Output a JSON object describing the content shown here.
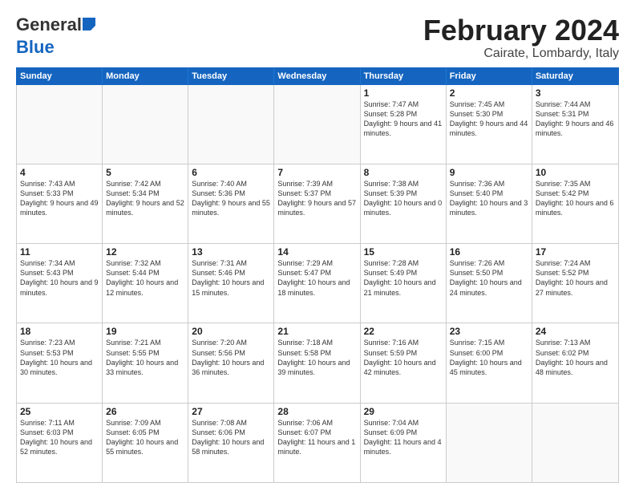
{
  "header": {
    "logo_general": "General",
    "logo_blue": "Blue",
    "month_title": "February 2024",
    "location": "Cairate, Lombardy, Italy"
  },
  "weekdays": [
    "Sunday",
    "Monday",
    "Tuesday",
    "Wednesday",
    "Thursday",
    "Friday",
    "Saturday"
  ],
  "rows": [
    [
      {
        "day": "",
        "text": ""
      },
      {
        "day": "",
        "text": ""
      },
      {
        "day": "",
        "text": ""
      },
      {
        "day": "",
        "text": ""
      },
      {
        "day": "1",
        "text": "Sunrise: 7:47 AM\nSunset: 5:28 PM\nDaylight: 9 hours\nand 41 minutes."
      },
      {
        "day": "2",
        "text": "Sunrise: 7:45 AM\nSunset: 5:30 PM\nDaylight: 9 hours\nand 44 minutes."
      },
      {
        "day": "3",
        "text": "Sunrise: 7:44 AM\nSunset: 5:31 PM\nDaylight: 9 hours\nand 46 minutes."
      }
    ],
    [
      {
        "day": "4",
        "text": "Sunrise: 7:43 AM\nSunset: 5:33 PM\nDaylight: 9 hours\nand 49 minutes."
      },
      {
        "day": "5",
        "text": "Sunrise: 7:42 AM\nSunset: 5:34 PM\nDaylight: 9 hours\nand 52 minutes."
      },
      {
        "day": "6",
        "text": "Sunrise: 7:40 AM\nSunset: 5:36 PM\nDaylight: 9 hours\nand 55 minutes."
      },
      {
        "day": "7",
        "text": "Sunrise: 7:39 AM\nSunset: 5:37 PM\nDaylight: 9 hours\nand 57 minutes."
      },
      {
        "day": "8",
        "text": "Sunrise: 7:38 AM\nSunset: 5:39 PM\nDaylight: 10 hours\nand 0 minutes."
      },
      {
        "day": "9",
        "text": "Sunrise: 7:36 AM\nSunset: 5:40 PM\nDaylight: 10 hours\nand 3 minutes."
      },
      {
        "day": "10",
        "text": "Sunrise: 7:35 AM\nSunset: 5:42 PM\nDaylight: 10 hours\nand 6 minutes."
      }
    ],
    [
      {
        "day": "11",
        "text": "Sunrise: 7:34 AM\nSunset: 5:43 PM\nDaylight: 10 hours\nand 9 minutes."
      },
      {
        "day": "12",
        "text": "Sunrise: 7:32 AM\nSunset: 5:44 PM\nDaylight: 10 hours\nand 12 minutes."
      },
      {
        "day": "13",
        "text": "Sunrise: 7:31 AM\nSunset: 5:46 PM\nDaylight: 10 hours\nand 15 minutes."
      },
      {
        "day": "14",
        "text": "Sunrise: 7:29 AM\nSunset: 5:47 PM\nDaylight: 10 hours\nand 18 minutes."
      },
      {
        "day": "15",
        "text": "Sunrise: 7:28 AM\nSunset: 5:49 PM\nDaylight: 10 hours\nand 21 minutes."
      },
      {
        "day": "16",
        "text": "Sunrise: 7:26 AM\nSunset: 5:50 PM\nDaylight: 10 hours\nand 24 minutes."
      },
      {
        "day": "17",
        "text": "Sunrise: 7:24 AM\nSunset: 5:52 PM\nDaylight: 10 hours\nand 27 minutes."
      }
    ],
    [
      {
        "day": "18",
        "text": "Sunrise: 7:23 AM\nSunset: 5:53 PM\nDaylight: 10 hours\nand 30 minutes."
      },
      {
        "day": "19",
        "text": "Sunrise: 7:21 AM\nSunset: 5:55 PM\nDaylight: 10 hours\nand 33 minutes."
      },
      {
        "day": "20",
        "text": "Sunrise: 7:20 AM\nSunset: 5:56 PM\nDaylight: 10 hours\nand 36 minutes."
      },
      {
        "day": "21",
        "text": "Sunrise: 7:18 AM\nSunset: 5:58 PM\nDaylight: 10 hours\nand 39 minutes."
      },
      {
        "day": "22",
        "text": "Sunrise: 7:16 AM\nSunset: 5:59 PM\nDaylight: 10 hours\nand 42 minutes."
      },
      {
        "day": "23",
        "text": "Sunrise: 7:15 AM\nSunset: 6:00 PM\nDaylight: 10 hours\nand 45 minutes."
      },
      {
        "day": "24",
        "text": "Sunrise: 7:13 AM\nSunset: 6:02 PM\nDaylight: 10 hours\nand 48 minutes."
      }
    ],
    [
      {
        "day": "25",
        "text": "Sunrise: 7:11 AM\nSunset: 6:03 PM\nDaylight: 10 hours\nand 52 minutes."
      },
      {
        "day": "26",
        "text": "Sunrise: 7:09 AM\nSunset: 6:05 PM\nDaylight: 10 hours\nand 55 minutes."
      },
      {
        "day": "27",
        "text": "Sunrise: 7:08 AM\nSunset: 6:06 PM\nDaylight: 10 hours\nand 58 minutes."
      },
      {
        "day": "28",
        "text": "Sunrise: 7:06 AM\nSunset: 6:07 PM\nDaylight: 11 hours\nand 1 minute."
      },
      {
        "day": "29",
        "text": "Sunrise: 7:04 AM\nSunset: 6:09 PM\nDaylight: 11 hours\nand 4 minutes."
      },
      {
        "day": "",
        "text": ""
      },
      {
        "day": "",
        "text": ""
      }
    ]
  ]
}
